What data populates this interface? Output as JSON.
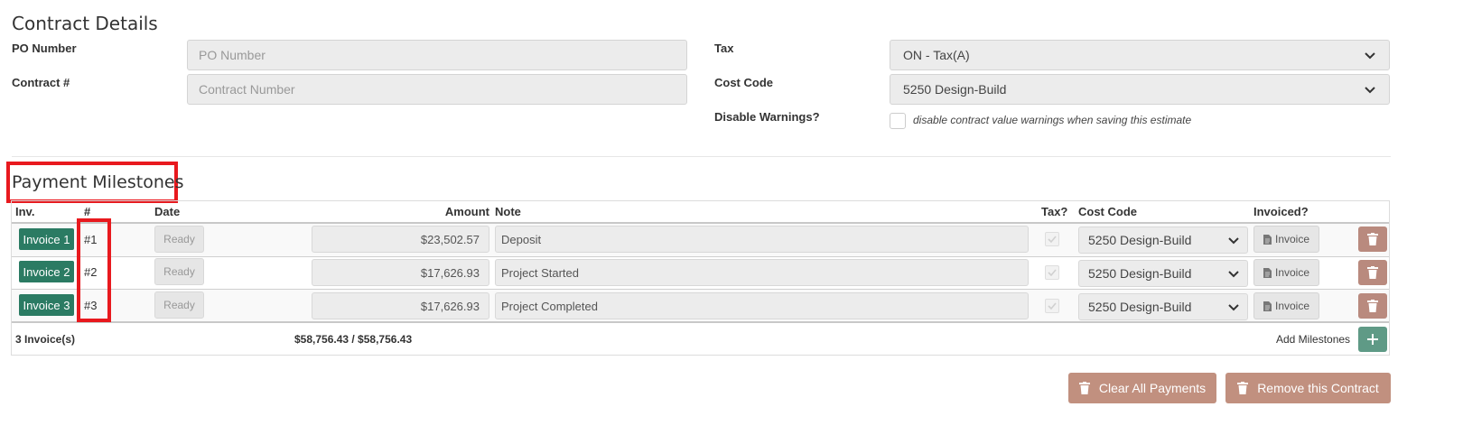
{
  "contract": {
    "title": "Contract Details",
    "po_label": "PO Number",
    "po_placeholder": "PO Number",
    "contract_label": "Contract #",
    "contract_placeholder": "Contract Number",
    "tax_label": "Tax",
    "tax_value": "ON - Tax(A)",
    "cost_code_label": "Cost Code",
    "cost_code_value": "5250 Design-Build",
    "disable_label": "Disable Warnings?",
    "disable_text": "disable contract value warnings when saving this estimate"
  },
  "milestones": {
    "title": "Payment Milestones",
    "headers": {
      "inv": "Inv.",
      "num": "#",
      "date": "Date",
      "amount": "Amount",
      "note": "Note",
      "tax": "Tax?",
      "cost_code": "Cost Code",
      "invoiced": "Invoiced?"
    },
    "rows": [
      {
        "invoice": "Invoice 1",
        "num": "#1",
        "date": "Ready",
        "amount": "$23,502.57",
        "note": "Deposit",
        "cost_code": "5250 Design-Build",
        "invoiced": "Invoice"
      },
      {
        "invoice": "Invoice 2",
        "num": "#2",
        "date": "Ready",
        "amount": "$17,626.93",
        "note": "Project Started",
        "cost_code": "5250 Design-Build",
        "invoiced": "Invoice"
      },
      {
        "invoice": "Invoice 3",
        "num": "#3",
        "date": "Ready",
        "amount": "$17,626.93",
        "note": "Project Completed",
        "cost_code": "5250 Design-Build",
        "invoiced": "Invoice"
      }
    ],
    "footer": {
      "count": "3 Invoice(s)",
      "total": "$58,756.43 / $58,756.43",
      "add_label": "Add Milestones"
    }
  },
  "actions": {
    "clear": "Clear All Payments",
    "remove": "Remove this Contract"
  },
  "colors": {
    "accent_green": "#2b7b63",
    "danger_muted": "#c1907f",
    "highlight_red": "#e8191e"
  }
}
